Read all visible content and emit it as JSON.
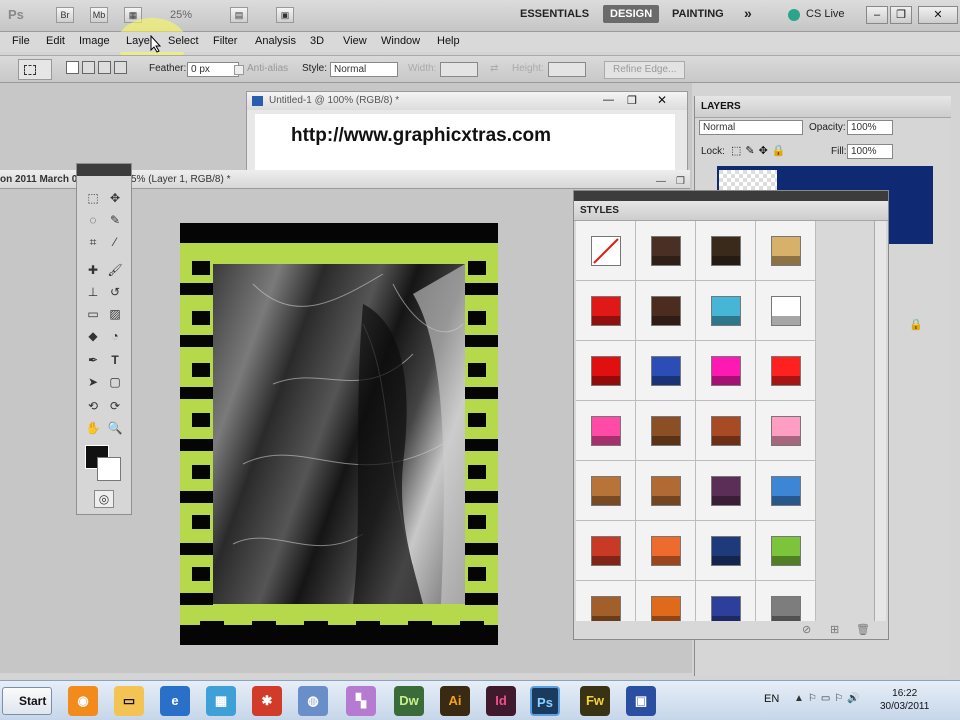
{
  "appbar": {
    "logo": "Ps",
    "zoom": "25%",
    "workspaces": [
      "ESSENTIALS",
      "DESIGN",
      "PAINTING"
    ],
    "active_workspace": "DESIGN",
    "overflow": "»",
    "cslive": "CS Live"
  },
  "menu": [
    "File",
    "Edit",
    "Image",
    "Layer",
    "Select",
    "Filter",
    "Analysis",
    "3D",
    "View",
    "Window",
    "Help"
  ],
  "options": {
    "feather_label": "Feather:",
    "feather_value": "0 px",
    "antialias_label": "Anti-alias",
    "style_label": "Style:",
    "style_value": "Normal",
    "width_label": "Width:",
    "height_label": "Height:",
    "refine_edge": "Refine Edge..."
  },
  "docs": {
    "secondary_title": "Untitled-1 @ 100% (RGB/8) *",
    "secondary_url": "http://www.graphicxtras.com",
    "main_title": "on 2011 March 0",
    "main_title_suffix": "5% (Layer 1, RGB/8) *"
  },
  "styles_panel": {
    "tab": "STYLES",
    "swatches": [
      [
        "none",
        "#4a3024",
        "#3a2a1c",
        "#d7b06a"
      ],
      [
        "#e01818",
        "#4b2c1f",
        "#47b6d6",
        "#ffffff"
      ],
      [
        "#e01010",
        "#2b4db5",
        "#ff19b3",
        "#ff2020"
      ],
      [
        "#ff4aa6",
        "#8a4f24",
        "#a84a24",
        "#ff9ec2"
      ],
      [
        "#b87438",
        "#b26a34",
        "#5a2e57",
        "#3d86d6"
      ],
      [
        "#c83a26",
        "#ee6b30",
        "#1e3a7a",
        "#7bc43b"
      ],
      [
        "#a25f2c",
        "#e06a1c",
        "#2d3f9a",
        "#7d7d7d"
      ]
    ]
  },
  "layers_panel": {
    "tab": "LAYERS",
    "blend_mode": "Normal",
    "opacity_label": "Opacity:",
    "opacity_value": "100%",
    "lock_label": "Lock:",
    "fill_label": "Fill:",
    "fill_value": "100%"
  },
  "taskbar": {
    "start": "Start",
    "apps": [
      "Dw",
      "Ai",
      "Id",
      "Ps",
      "Fw"
    ],
    "language": "EN",
    "time": "16:22",
    "date": "30/03/2011"
  }
}
